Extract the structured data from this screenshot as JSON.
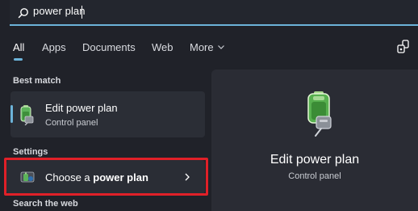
{
  "search": {
    "icon": "search-icon",
    "value": "power plan"
  },
  "tabs": [
    {
      "label": "All",
      "active": true
    },
    {
      "label": "Apps"
    },
    {
      "label": "Documents"
    },
    {
      "label": "Web"
    },
    {
      "label": "More"
    }
  ],
  "toolbar": {
    "more_icon": "chevron-down-icon",
    "share_icon": "connected-devices-icon"
  },
  "best_match": {
    "heading": "Best match",
    "title_prefix": "Edit ",
    "title_bold": "power plan",
    "subtitle": "Control panel",
    "icon": "battery-plug-icon"
  },
  "settings": {
    "heading": "Settings",
    "item": {
      "prefix": "Choose a ",
      "bold": "power plan",
      "icon": "power-options-icon",
      "arrow": "chevron-right-icon"
    }
  },
  "web": {
    "heading": "Search the web"
  },
  "preview": {
    "title": "Edit power plan",
    "subtitle": "Control panel",
    "icon": "battery-plug-icon"
  },
  "colors": {
    "accent": "#6cb3d9",
    "highlight": "#e02028",
    "background": "#202229"
  }
}
